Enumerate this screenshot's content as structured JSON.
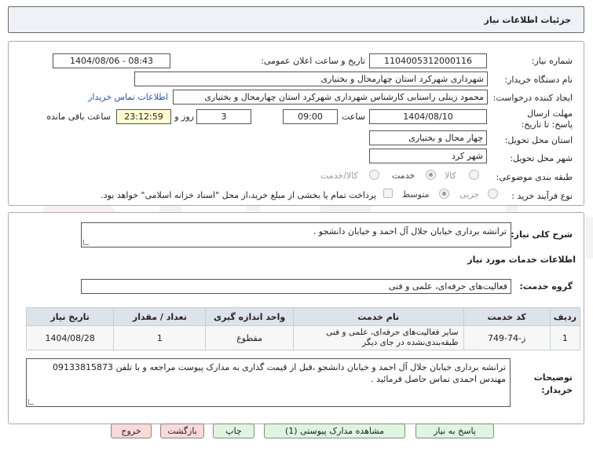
{
  "header": {
    "title": "جزئیات اطلاعات نیاز"
  },
  "form": {
    "need_number_label": "شماره نیاز:",
    "need_number": "1104005312000116",
    "announce_label": "تاریخ و ساعت اعلان عمومی:",
    "announce_value": "1404/08/06 - 08:43",
    "buyer_org_label": "نام دستگاه خریدار:",
    "buyer_org": "شهرداری شهرکرد استان چهارمحال و بختیاری",
    "creator_label": "ایجاد کننده درخواست:",
    "creator": "محمود زینلی راستابی کارشناس شهرداری شهرکرد استان چهارمحال و بختیاری",
    "contact_link": "اطلاعات تماس خریدار",
    "deadline_label": "مهلت ارسال پاسخ: تا تاریخ:",
    "deadline_date": "1404/08/10",
    "time_label": "ساعت",
    "deadline_time": "09:00",
    "days_value": "3",
    "days_label": "روز و",
    "remaining_time": "23:12:59",
    "remaining_label": "ساعت باقی مانده",
    "province_label": "استان محل تحویل:",
    "province": "چهار محال و بختیاری",
    "city_label": "شهر محل تحویل:",
    "city": "شهر کرد",
    "category_label": "طبقه بندی موضوعی:",
    "category_options": [
      "کالا",
      "خدمت",
      "کالا/خدمت"
    ],
    "category_selected": "خدمت",
    "process_label": "نوع فرآیند خرید :",
    "process_options": [
      "جزیی",
      "متوسط"
    ],
    "process_selected": "متوسط",
    "payment_note": "پرداخت تمام یا بخشی از مبلغ خرید،از محل \"اسناد خزانه اسلامی\" خواهد بود."
  },
  "details": {
    "summary_label": "شرح کلی نیاز:",
    "summary": "ترانشه برداری خیابان جلال آل احمد و خیابان دانشجو .",
    "services_heading": "اطلاعات خدمات مورد نیاز",
    "service_group_label": "گروه خدمت:",
    "service_group": "فعالیت‌های حرفه‌ای، علمی و فنی"
  },
  "table": {
    "headers": [
      "ردیف",
      "کد خدمت",
      "نام خدمت",
      "واحد اندازه گیری",
      "تعداد / مقدار",
      "تاریخ نیاز"
    ],
    "rows": [
      [
        "1",
        "ز-74-749",
        "سایر فعالیت‌های حرفه‌ای، علمی و فنی طبقه‌بندی‌نشده در جای دیگر",
        "مقطوع",
        "1",
        "1404/08/28"
      ]
    ]
  },
  "notes": {
    "label": "توضیحات خریدار:",
    "text": "ترانشه برداری خیابان جلال آل احمد و خیابان دانشجو ،قبل از قیمت گذاری به مدارک پیوست مراجعه و با تلفن 09133815873 مهندس احمدی تماس حاصل فرمائید ."
  },
  "buttons": {
    "reply": "پاسخ به نیاز",
    "view_docs": "مشاهده مدارک پیوستی (1)",
    "print": "چاپ",
    "back": "بازگشت",
    "exit": "خروج"
  },
  "watermark": {
    "text": "AriaTender.net"
  }
}
